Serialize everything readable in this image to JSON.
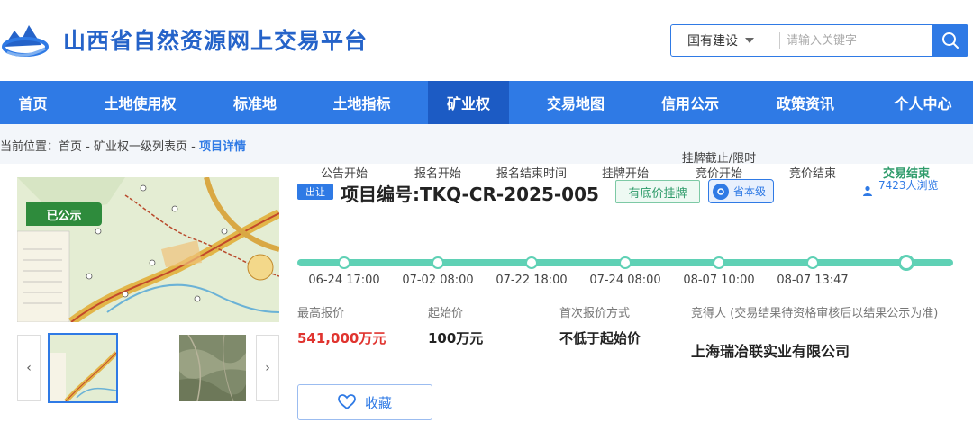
{
  "site": {
    "title": "山西省自然资源网上交易平台"
  },
  "search": {
    "category": "国有建设",
    "placeholder": "请输入关键字"
  },
  "nav": {
    "items": [
      {
        "label": "首页"
      },
      {
        "label": "土地使用权"
      },
      {
        "label": "标准地"
      },
      {
        "label": "土地指标"
      },
      {
        "label": "矿业权"
      },
      {
        "label": "交易地图"
      },
      {
        "label": "信用公示"
      },
      {
        "label": "政策资讯"
      },
      {
        "label": "个人中心"
      }
    ],
    "active_index": 4
  },
  "breadcrumb": {
    "prefix": "当前位置：",
    "home": "首页",
    "sep1": " - ",
    "list": "矿业权一级列表页",
    "sep2": " - ",
    "current": "项目详情"
  },
  "project": {
    "published_badge": "已公示",
    "type_tag": "出让",
    "title": "项目编号:TKQ-CR-2025-005",
    "reserve_tag": "有底价挂牌",
    "level_tag": "省本级",
    "views": "7423人浏览"
  },
  "timeline": [
    {
      "label": "公告开始",
      "time": "06-24 17:00"
    },
    {
      "label": "报名开始",
      "time": "07-02 08:00"
    },
    {
      "label": "报名结束时间",
      "time": "07-22 18:00"
    },
    {
      "label": "挂牌开始",
      "time": "07-24 08:00"
    },
    {
      "label": "挂牌截止/限时竞价开始",
      "time": "08-07 10:00"
    },
    {
      "label": "竞价结束",
      "time": "08-07 13:47"
    },
    {
      "label": "交易结束",
      "time": ""
    }
  ],
  "info": {
    "highest_label": "最高报价",
    "highest_value": "541,000万元",
    "start_label": "起始价",
    "start_value": "100万元",
    "first_quote_label": "首次报价方式",
    "first_quote_value": "不低于起始价",
    "winner_label": "竞得人 (交易结果待资格审核后以结果公示为准)",
    "winner_value": "上海瑞冶联实业有限公司"
  },
  "favorite": {
    "label": "收藏"
  },
  "colors": {
    "primary": "#2f7ae5",
    "nav_active": "#1c5bc4",
    "price_red": "#e0342f",
    "green": "#2e8b3c",
    "timeline": "#5fd1b5"
  }
}
